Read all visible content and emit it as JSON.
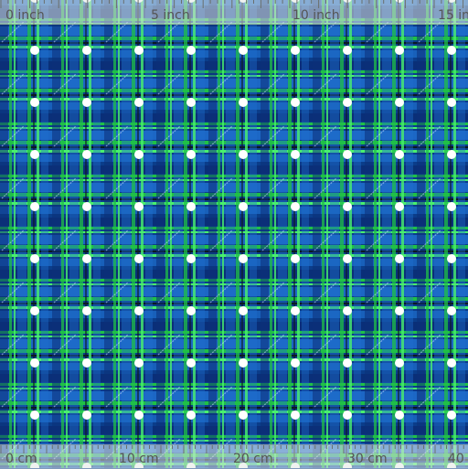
{
  "colors": {
    "navy": "#0a2f78",
    "blue": "#1e6fcf",
    "green": "#1fc046",
    "bright_green": "#49f06e",
    "black": "#0b1a22",
    "dot": "#ffffff",
    "ruler_bg": "#e1e8e4",
    "ruler_text": "#555555"
  },
  "pattern": {
    "name": "tartan-plaid-with-white-dots",
    "dot_columns": 9,
    "dot_rows": 8,
    "watermark_text": "spoonflower"
  },
  "ruler_top": {
    "unit": "inch",
    "labels": [
      "0 inch",
      "5 inch",
      "10 inch",
      "15 in"
    ]
  },
  "ruler_bottom": {
    "unit": "cm",
    "labels": [
      "0 cm",
      "10 cm",
      "20 cm",
      "30 cm",
      "40"
    ]
  }
}
